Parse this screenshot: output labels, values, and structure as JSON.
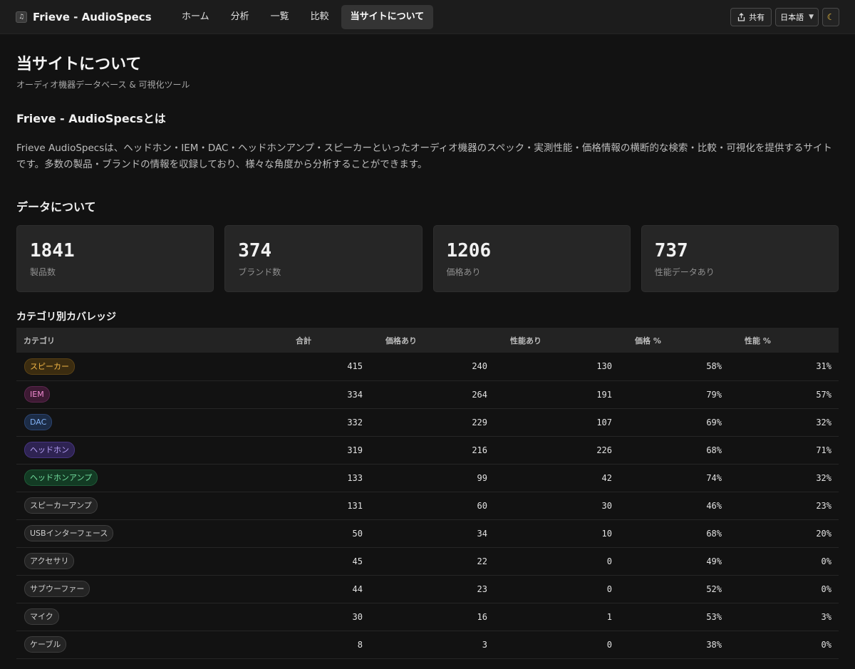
{
  "header": {
    "brand": "Frieve - AudioSpecs",
    "nav": [
      "ホーム",
      "分析",
      "一覧",
      "比較",
      "当サイトについて"
    ],
    "active_nav": 4,
    "share_label": "共有",
    "language": "日本語",
    "theme_icon": "moon-icon"
  },
  "page": {
    "title": "当サイトについて",
    "subtitle": "オーディオ機器データベース & 可視化ツール",
    "about_heading": "Frieve - AudioSpecsとは",
    "about_text": "Frieve AudioSpecsは、ヘッドホン・IEM・DAC・ヘッドホンアンプ・スピーカーといったオーディオ機器のスペック・実測性能・価格情報の横断的な検索・比較・可視化を提供するサイトです。多数の製品・ブランドの情報を収録しており、様々な角度から分析することができます。",
    "data_heading": "データについて",
    "coverage_heading": "カテゴリ別カバレッジ"
  },
  "stats": [
    {
      "value": "1841",
      "label": "製品数"
    },
    {
      "value": "374",
      "label": "ブランド数"
    },
    {
      "value": "1206",
      "label": "価格あり"
    },
    {
      "value": "737",
      "label": "性能データあり"
    }
  ],
  "table": {
    "headers": [
      "カテゴリ",
      "合計",
      "価格あり",
      "性能あり",
      "価格 %",
      "性能 %"
    ],
    "rows": [
      {
        "category": "スピーカー",
        "style": "b-speaker",
        "total": "415",
        "price": "240",
        "perf": "130",
        "price_pct": "58%",
        "perf_pct": "31%"
      },
      {
        "category": "IEM",
        "style": "b-iem",
        "total": "334",
        "price": "264",
        "perf": "191",
        "price_pct": "79%",
        "perf_pct": "57%"
      },
      {
        "category": "DAC",
        "style": "b-dac",
        "total": "332",
        "price": "229",
        "perf": "107",
        "price_pct": "69%",
        "perf_pct": "32%"
      },
      {
        "category": "ヘッドホン",
        "style": "b-hp",
        "total": "319",
        "price": "216",
        "perf": "226",
        "price_pct": "68%",
        "perf_pct": "71%"
      },
      {
        "category": "ヘッドホンアンプ",
        "style": "b-hpamp",
        "total": "133",
        "price": "99",
        "perf": "42",
        "price_pct": "74%",
        "perf_pct": "32%"
      },
      {
        "category": "スピーカーアンプ",
        "style": "b-neutral",
        "total": "131",
        "price": "60",
        "perf": "30",
        "price_pct": "46%",
        "perf_pct": "23%"
      },
      {
        "category": "USBインターフェース",
        "style": "b-neutral",
        "total": "50",
        "price": "34",
        "perf": "10",
        "price_pct": "68%",
        "perf_pct": "20%"
      },
      {
        "category": "アクセサリ",
        "style": "b-neutral",
        "total": "45",
        "price": "22",
        "perf": "0",
        "price_pct": "49%",
        "perf_pct": "0%"
      },
      {
        "category": "サブウーファー",
        "style": "b-neutral",
        "total": "44",
        "price": "23",
        "perf": "0",
        "price_pct": "52%",
        "perf_pct": "0%"
      },
      {
        "category": "マイク",
        "style": "b-neutral",
        "total": "30",
        "price": "16",
        "perf": "1",
        "price_pct": "53%",
        "perf_pct": "3%"
      },
      {
        "category": "ケーブル",
        "style": "b-neutral",
        "total": "8",
        "price": "3",
        "perf": "0",
        "price_pct": "38%",
        "perf_pct": "0%"
      }
    ]
  }
}
